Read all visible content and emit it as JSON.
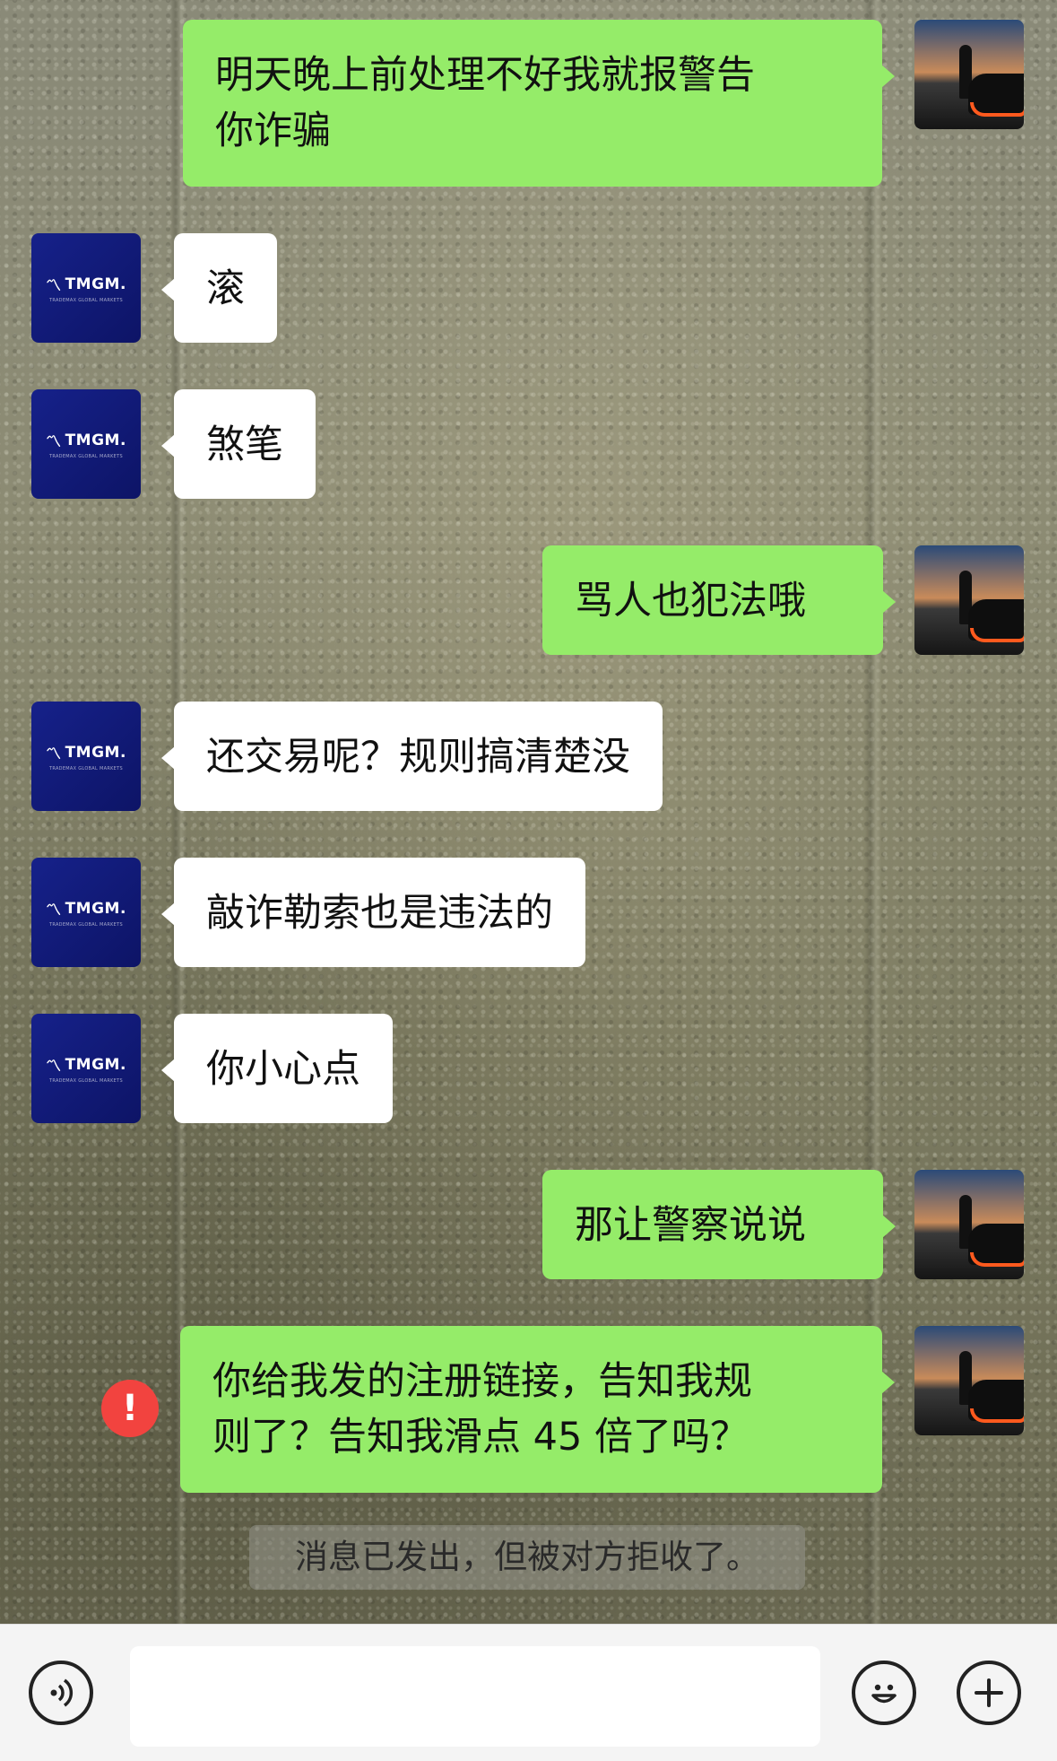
{
  "messages": [
    {
      "from": "me",
      "lines": [
        "明天晚上前处理不好我就报警告",
        "你诈骗"
      ]
    },
    {
      "from": "them",
      "lines": [
        "滚"
      ]
    },
    {
      "from": "them",
      "lines": [
        "煞笔"
      ]
    },
    {
      "from": "me",
      "lines": [
        "骂人也犯法哦"
      ]
    },
    {
      "from": "them",
      "lines": [
        "还交易呢？规则搞清楚没"
      ]
    },
    {
      "from": "them",
      "lines": [
        "敲诈勒索也是违法的"
      ]
    },
    {
      "from": "them",
      "lines": [
        "你小心点"
      ]
    },
    {
      "from": "me",
      "lines": [
        "那让警察说说"
      ]
    },
    {
      "from": "me",
      "lines": [
        "你给我发的注册链接，告知我规",
        "则了？告知我滑点 45 倍了吗？"
      ],
      "status": "failed"
    }
  ],
  "contact_avatar": {
    "brand": "TMGM.",
    "tagline": "TRADEMAX GLOBAL MARKETS"
  },
  "system_notice": "消息已发出，但被对方拒收了。",
  "failed_mark": "!",
  "input_bar": {
    "value": ""
  },
  "colors": {
    "outgoing_bubble": "#95ec69",
    "incoming_bubble": "#ffffff",
    "failed_icon": "#f2433f"
  }
}
